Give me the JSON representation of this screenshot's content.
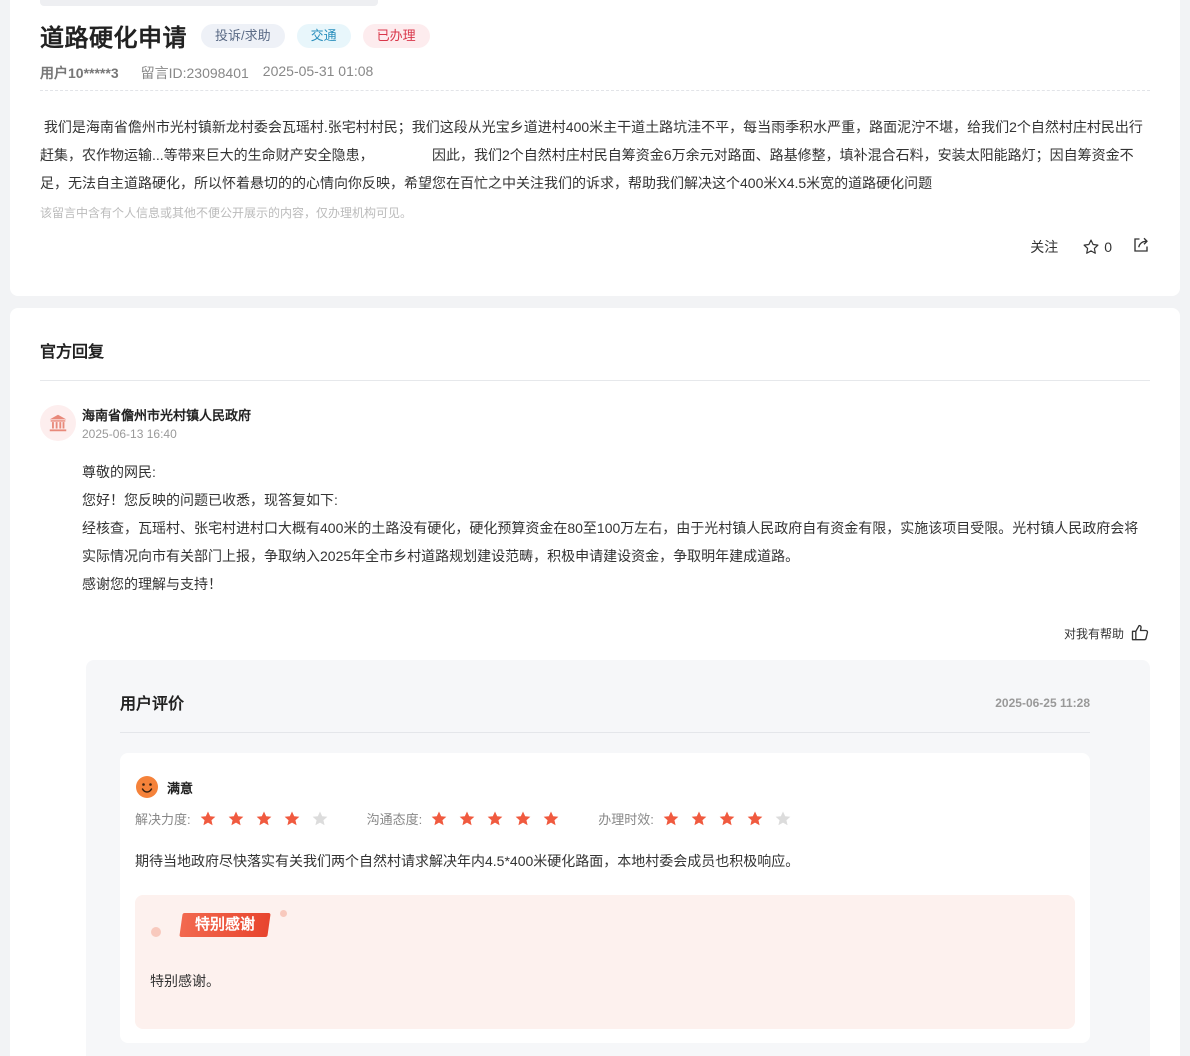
{
  "message": {
    "title": "道路硬化申请",
    "tags": {
      "type": "投诉/求助",
      "category": "交通",
      "status": "已办理"
    },
    "user": "用户10*****3",
    "message_id": "留言ID:23098401",
    "time": "2025-05-31 01:08",
    "content": " 我们是海南省儋州市光村镇新龙村委会瓦瑶村.张宅村村民；我们这段从光宝乡道进村400米主干道土路坑洼不平，每当雨季积水严重，路面泥泞不堪，给我们2个自然村庄村民出行赶集，农作物运输...等带来巨大的生命财产安全隐患，               因此，我们2个自然村庄村民自筹资金6万余元对路面、路基修整，填补混合石料，安装太阳能路灯；因自筹资金不足，无法自主道路硬化，所以怀着悬切的的心情向你反映，希望您在百忙之中关注我们的诉求，帮助我们解决这个400米X4.5米宽的道路硬化问题",
    "privacy_note": "该留言中含有个人信息或其他不便公开展示的内容，仅办理机构可见。",
    "actions": {
      "follow": "关注",
      "star_count": "0"
    }
  },
  "reply_section": {
    "title": "官方回复",
    "org_icon": "government-building-icon",
    "org_name": "海南省儋州市光村镇人民政府",
    "reply_time": "2025-06-13 16:40",
    "paragraphs": [
      "尊敬的网民:",
      "您好！您反映的问题已收悉，现答复如下:",
      "经核查，瓦瑶村、张宅村进村口大概有400米的土路没有硬化，硬化预算资金在80至100万左右，由于光村镇人民政府自有资金有限，实施该项目受限。光村镇人民政府会将实际情况向市有关部门上报，争取纳入2025年全市乡村道路规划建设范畴，积极申请建设资金，争取明年建成道路。",
      "感谢您的理解与支持！"
    ],
    "helpful_label": "对我有帮助"
  },
  "evaluation": {
    "title": "用户评价",
    "time": "2025-06-25 11:28",
    "satisfaction": "满意",
    "ratings": [
      {
        "label": "解决力度:",
        "score": 4,
        "max": 5
      },
      {
        "label": "沟通态度:",
        "score": 5,
        "max": 5
      },
      {
        "label": "办理时效:",
        "score": 4,
        "max": 5
      }
    ],
    "comment": "期待当地政府尽快落实有关我们两个自然村请求解决年内4.5*400米硬化路面，本地村委会成员也积极响应。",
    "thanks_badge": "特别感谢",
    "thanks_text": "特别感谢。"
  },
  "colors": {
    "star_on": "#f05a3f",
    "star_off": "#dcdcdc",
    "status_red": "#d9364a"
  }
}
